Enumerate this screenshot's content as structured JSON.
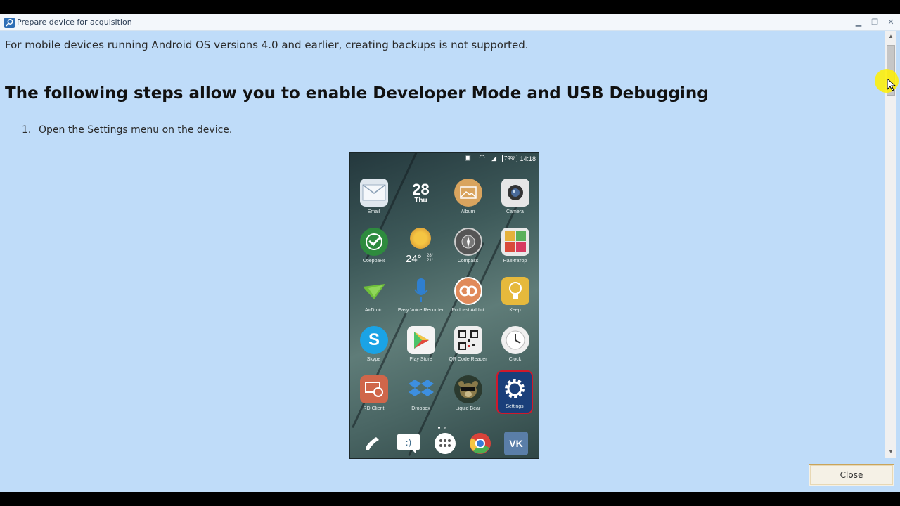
{
  "window": {
    "title": "Prepare device for acquisition",
    "minimize_icon": "minimize-icon",
    "maximize_icon": "maximize-icon",
    "close_icon": "close-icon"
  },
  "content": {
    "note": "For mobile devices running Android OS versions 4.0 and earlier, creating backups is not supported.",
    "heading": "The following steps allow you to enable Developer Mode and USB Debugging",
    "steps": [
      {
        "number": "1.",
        "text": "Open the Settings menu on the device."
      }
    ]
  },
  "phone": {
    "status": {
      "battery": "79%",
      "time": "14:18"
    },
    "widget": {
      "day": "28",
      "weekday": "Thu",
      "temperature": "24°",
      "temp_high": "28°",
      "temp_low": "21°"
    },
    "apps": [
      {
        "label": "Email",
        "icon": "email-icon",
        "color": "#dfe7ee"
      },
      {
        "label": "",
        "icon": "calendar-widget",
        "color": ""
      },
      {
        "label": "Album",
        "icon": "album-icon",
        "color": "#d9a45e"
      },
      {
        "label": "Camera",
        "icon": "camera-icon",
        "color": "#e6e6e6"
      },
      {
        "label": "Сбербанк",
        "icon": "sberbank-icon",
        "color": "#2e8b3e"
      },
      {
        "label": "",
        "icon": "weather-widget",
        "color": ""
      },
      {
        "label": "Compass",
        "icon": "compass-icon",
        "color": "#555555"
      },
      {
        "label": "Навигатор",
        "icon": "navigator-icon",
        "color": "#e9e9e9"
      },
      {
        "label": "AirDroid",
        "icon": "airdroid-icon",
        "color": "#6fbf3a"
      },
      {
        "label": "Easy Voice Recorder",
        "icon": "microphone-icon",
        "color": "#2f7fd0"
      },
      {
        "label": "Podcast Addict",
        "icon": "podcast-icon",
        "color": "#e08a5a"
      },
      {
        "label": "Keep",
        "icon": "keep-icon",
        "color": "#e6b93c"
      },
      {
        "label": "Skype",
        "icon": "skype-icon",
        "color": "#1aa3e5"
      },
      {
        "label": "Play Store",
        "icon": "play-store-icon",
        "color": "#f4f4f4"
      },
      {
        "label": "QR Code Reader",
        "icon": "qr-code-icon",
        "color": "#eeeeee"
      },
      {
        "label": "Clock",
        "icon": "clock-icon",
        "color": "#f0f0f0"
      },
      {
        "label": "RD Client",
        "icon": "rd-client-icon",
        "color": "#d0664a"
      },
      {
        "label": "Dropbox",
        "icon": "dropbox-icon",
        "color": "#3d8fe0"
      },
      {
        "label": "Liquid Bear",
        "icon": "bear-icon",
        "color": "#2b3a2f"
      },
      {
        "label": "Settings",
        "icon": "settings-icon",
        "color": "#1a3f7a"
      }
    ],
    "dock": [
      {
        "icon": "phone-icon"
      },
      {
        "icon": "messages-icon"
      },
      {
        "icon": "app-drawer-icon"
      },
      {
        "icon": "chrome-icon"
      },
      {
        "icon": "vk-icon"
      }
    ],
    "highlight_color": "#d0192b"
  },
  "footer": {
    "close_label": "Close"
  },
  "colors": {
    "background": "#bfdcf9",
    "button_border": "#c9a45b",
    "cursor_halo": "#fff000"
  }
}
